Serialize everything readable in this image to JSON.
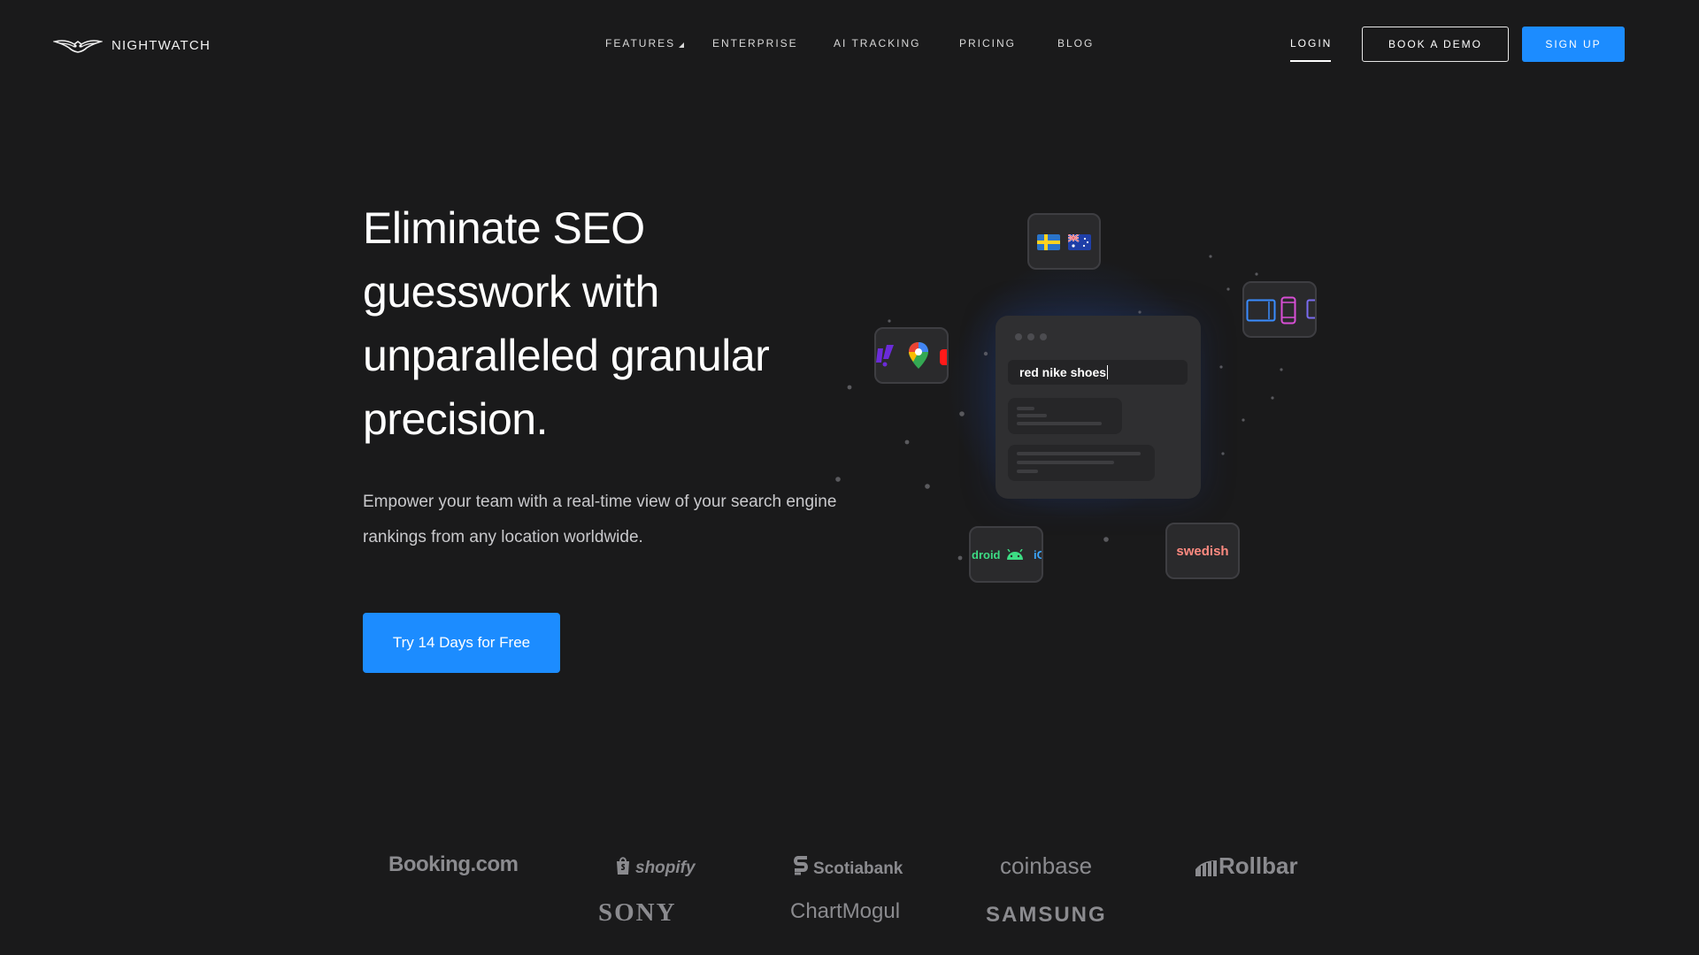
{
  "brand": {
    "name": "NIGHTWATCH",
    "logo_icon": "winged-owl-icon"
  },
  "nav": {
    "items": [
      {
        "label": "FEATURES",
        "has_dropdown": true
      },
      {
        "label": "ENTERPRISE"
      },
      {
        "label": "AI TRACKING"
      },
      {
        "label": "PRICING"
      },
      {
        "label": "BLOG"
      }
    ],
    "login": "LOGIN",
    "book_demo": "BOOK A DEMO",
    "sign_up": "SIGN UP"
  },
  "hero": {
    "title": "Eliminate SEO guesswork with unparalleled granular precision.",
    "subtitle": "Empower your team with a real-time view of your search engine rankings from any location worldwide.",
    "cta": "Try 14 Days for Free"
  },
  "illustration": {
    "search_query": "red nike shoes",
    "language_chip": "swedish",
    "os_chip_left": "droid",
    "os_chip_right": "iC",
    "flags": [
      "sweden-flag-icon",
      "australia-flag-icon"
    ],
    "engines": [
      "yahoo-icon",
      "google-maps-icon",
      "youtube-icon"
    ],
    "devices": [
      "tablet-icon",
      "phone-icon"
    ]
  },
  "logos": [
    "Booking.com",
    "shopify",
    "Scotiabank",
    "coinbase",
    "Rollbar",
    "SONY",
    "ChartMogul",
    "SAMSUNG"
  ],
  "colors": {
    "background": "#1a1a1b",
    "accent": "#1c8cff",
    "logo_gray": "#8b8b8f"
  }
}
